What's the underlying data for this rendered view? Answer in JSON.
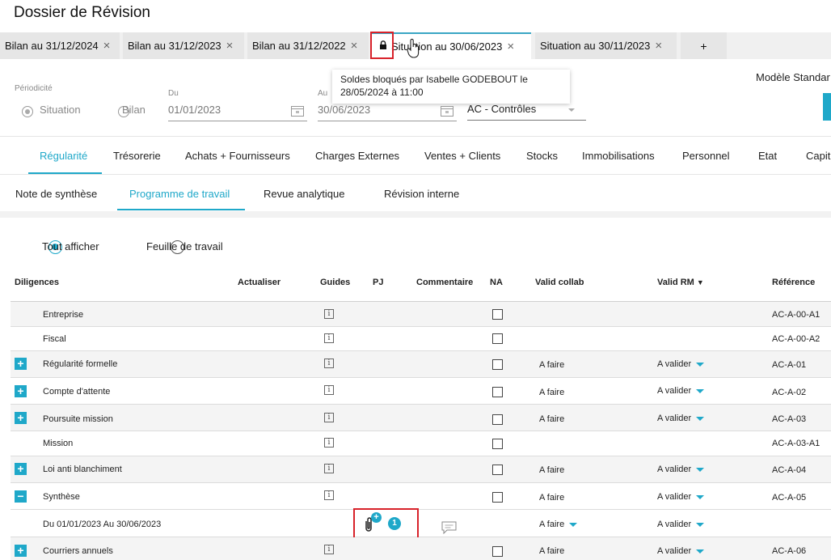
{
  "page": {
    "title": "Dossier de Révision"
  },
  "tabs": [
    {
      "label": "Bilan au 31/12/2024"
    },
    {
      "label": "Bilan au 31/12/2023"
    },
    {
      "label": "Bilan au 31/12/2022"
    },
    {
      "label": "Situation au 30/06/2023"
    },
    {
      "label": "Situation au 30/11/2023"
    },
    {
      "label": "+"
    }
  ],
  "tooltip": {
    "line1": "Soldes bloqués par Isabelle GODEBOUT le",
    "line2": "28/05/2024 à 11:00"
  },
  "header": {
    "model": "Modèle Standar"
  },
  "filters": {
    "periodicite_label": "Périodicité",
    "situation": "Situation",
    "bilan": "Bilan",
    "du_label": "Du",
    "du_value": "01/01/2023",
    "au_label": "Au",
    "au_value": "30/06/2023",
    "cycle_value": "AC - Contrôles"
  },
  "nav": [
    "Régularité",
    "Trésorerie",
    "Achats + Fournisseurs",
    "Charges Externes",
    "Ventes + Clients",
    "Stocks",
    "Immobilisations",
    "Personnel",
    "Etat",
    "Capit"
  ],
  "subnav": [
    "Note de synthèse",
    "Programme de travail",
    "Revue analytique",
    "Révision interne"
  ],
  "view": {
    "all": "Tout afficher",
    "sheet": "Feuille de travail"
  },
  "columns": {
    "diligences": "Diligences",
    "actualiser": "Actualiser",
    "guides": "Guides",
    "pj": "PJ",
    "commentaire": "Commentaire",
    "na": "NA",
    "valid_collab": "Valid collab",
    "valid_rm": "Valid RM",
    "reference": "Référence"
  },
  "rows": [
    {
      "name": "Entreprise",
      "collab": "",
      "rm": "",
      "ref": "AC-A-00-A1"
    },
    {
      "name": "Fiscal",
      "collab": "",
      "rm": "",
      "ref": "AC-A-00-A2"
    },
    {
      "name": "Régularité formelle",
      "collab": "A faire",
      "rm": "A valider",
      "ref": "AC-A-01"
    },
    {
      "name": "Compte d'attente",
      "collab": "A faire",
      "rm": "A valider",
      "ref": "AC-A-02"
    },
    {
      "name": "Poursuite mission",
      "collab": "A faire",
      "rm": "A valider",
      "ref": "AC-A-03"
    },
    {
      "name": "Mission",
      "collab": "",
      "rm": "",
      "ref": "AC-A-03-A1"
    },
    {
      "name": "Loi anti blanchiment",
      "collab": "A faire",
      "rm": "A valider",
      "ref": "AC-A-04"
    },
    {
      "name": "Synthèse",
      "collab": "A faire",
      "rm": "A valider",
      "ref": "AC-A-05"
    },
    {
      "name": "Du 01/01/2023 Au 30/06/2023",
      "collab": "A faire",
      "rm": "A valider",
      "ref": "",
      "pj_count": "1"
    },
    {
      "name": "Courriers annuels",
      "collab": "A faire",
      "rm": "A valider",
      "ref": "AC-A-06"
    }
  ]
}
